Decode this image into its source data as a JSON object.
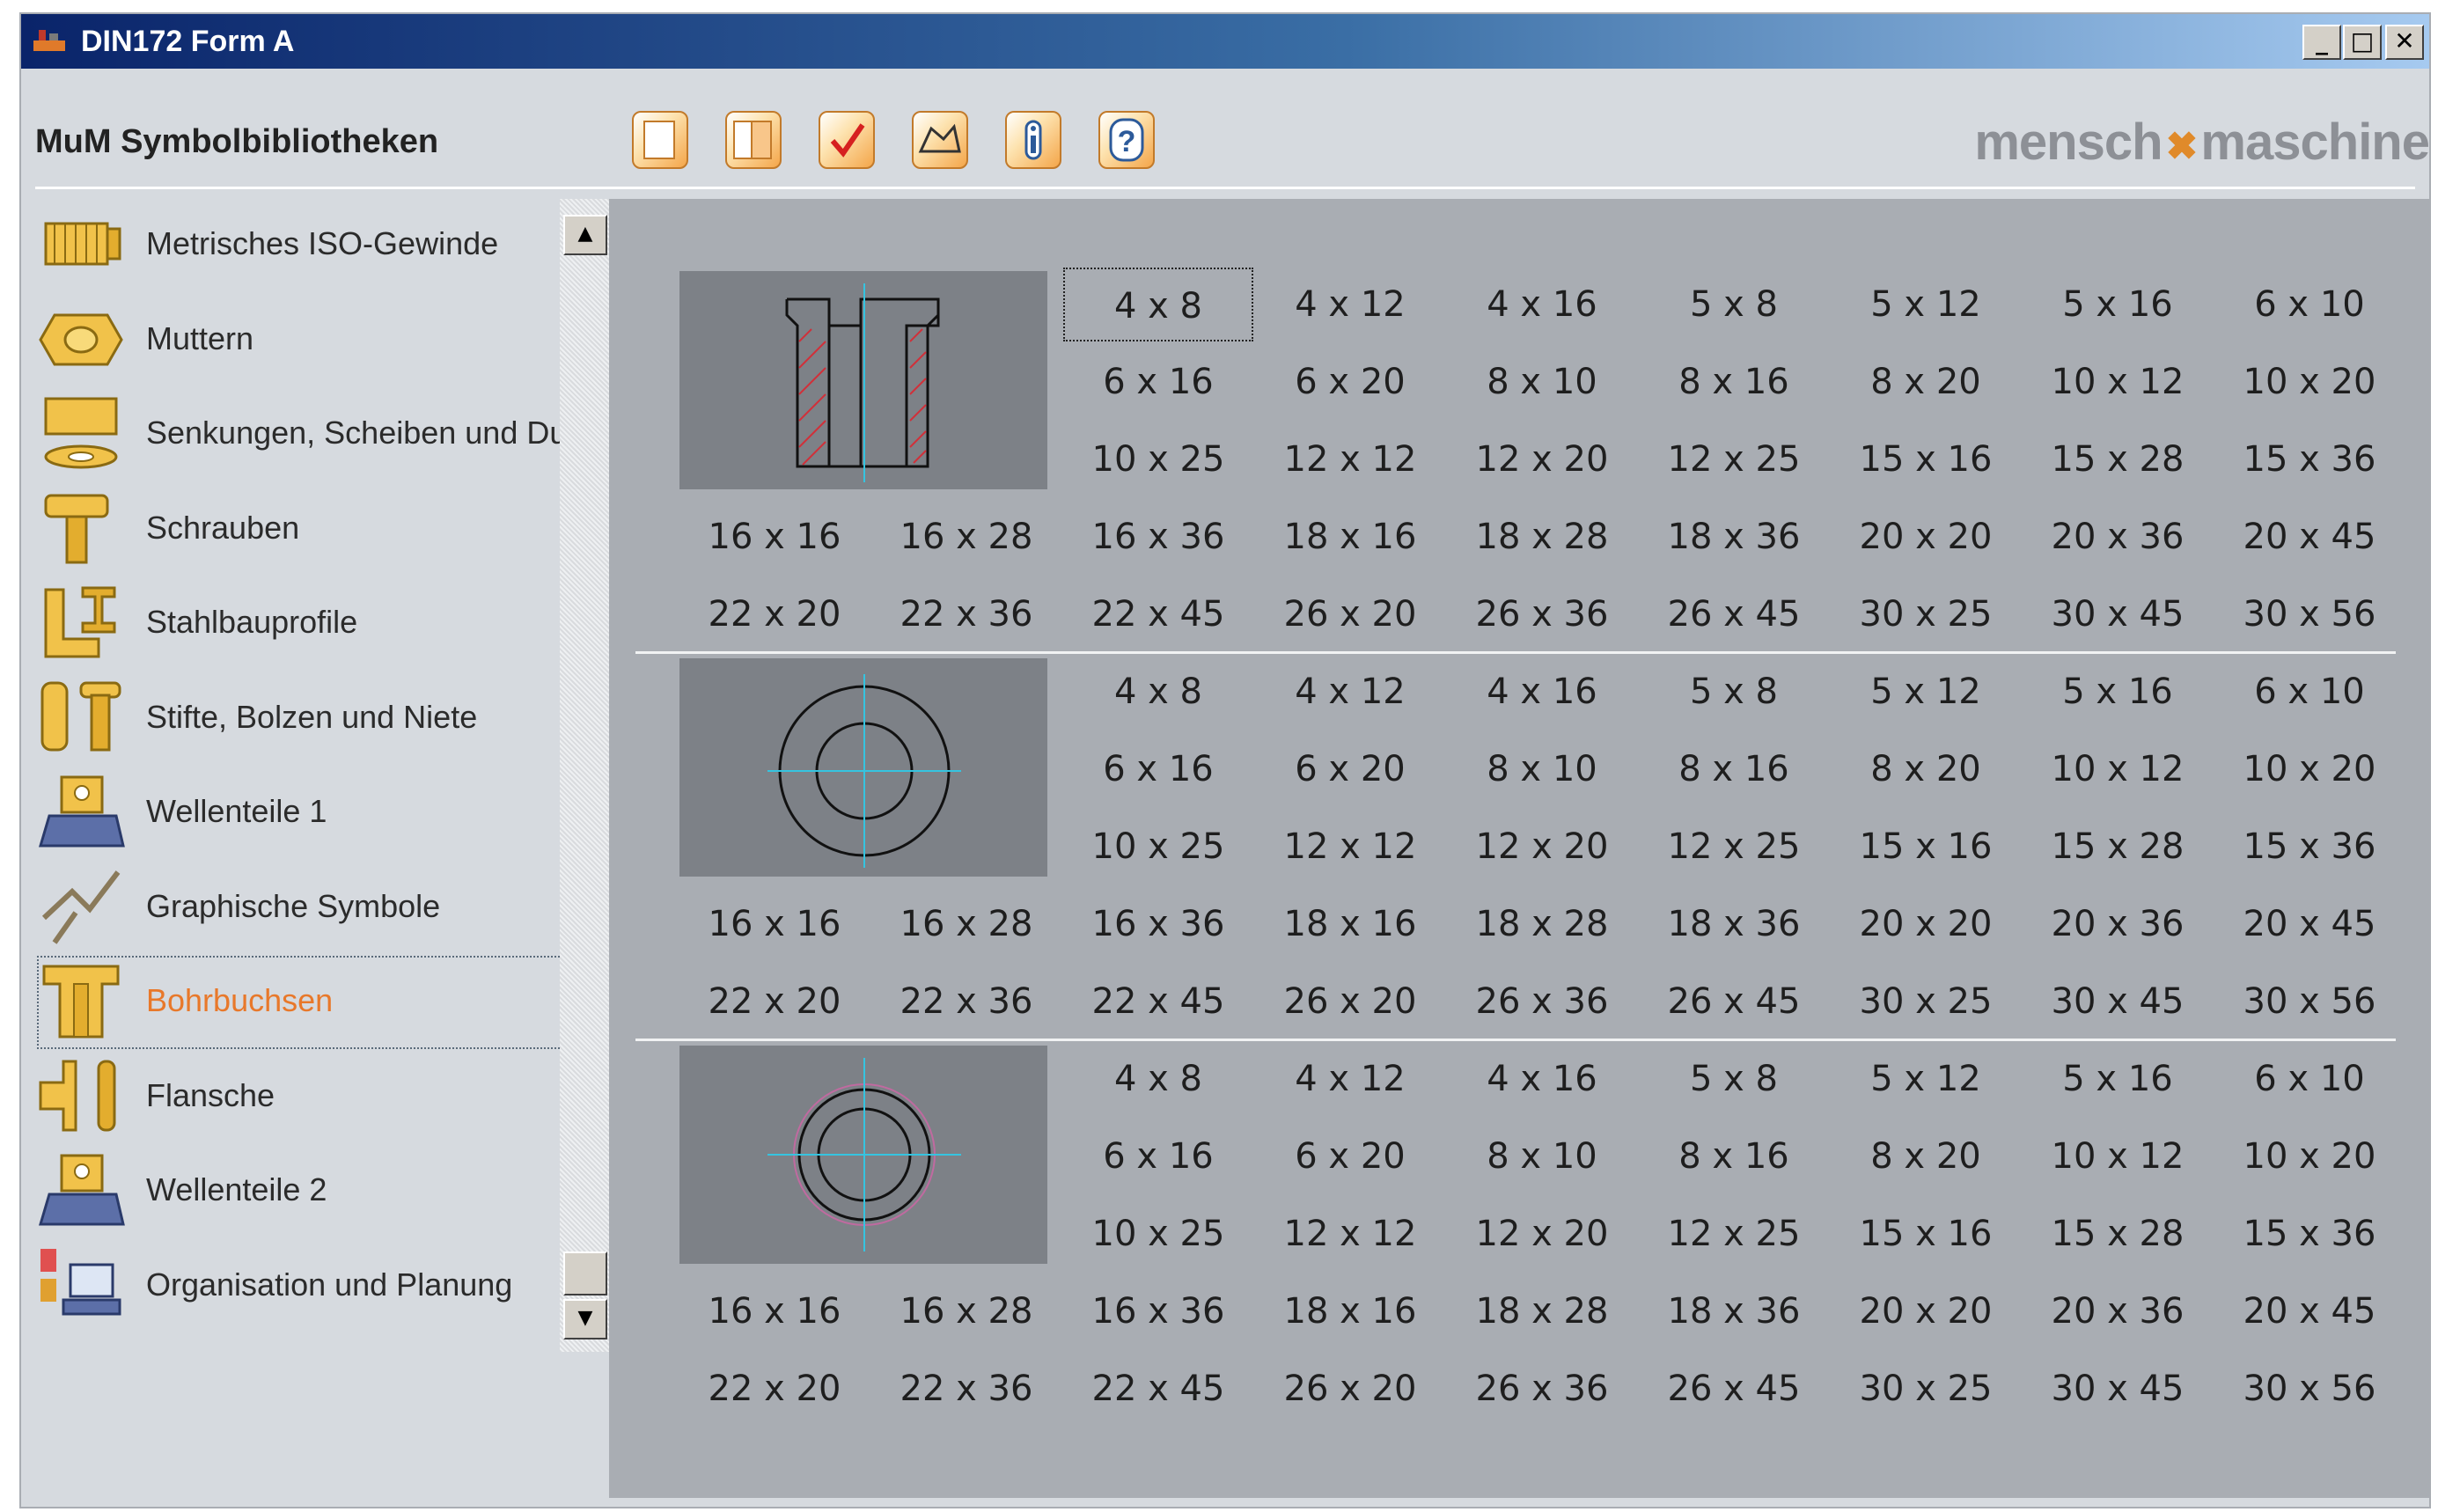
{
  "window": {
    "title": "DIN172 Form A",
    "minimize": "_",
    "maximize": "□",
    "close": "✕"
  },
  "header": {
    "brand_title": "MuM Symbolbibliotheken",
    "logo_left": "mensch",
    "logo_right": "maschine",
    "tools": [
      "new-icon",
      "page-icon",
      "check-icon",
      "folder-icon",
      "info-icon",
      "help-icon"
    ],
    "accent": "#f4a64a"
  },
  "sidebar": {
    "items": [
      {
        "label": "Metrisches ISO-Gewinde",
        "icon": "thread-icon"
      },
      {
        "label": "Muttern",
        "icon": "nut-icon"
      },
      {
        "label": "Senkungen, Scheiben und Du",
        "icon": "washer-icon"
      },
      {
        "label": "Schrauben",
        "icon": "screw-icon"
      },
      {
        "label": "Stahlbauprofile",
        "icon": "steel-profile-icon"
      },
      {
        "label": "Stifte, Bolzen und Niete",
        "icon": "pin-icon"
      },
      {
        "label": "Wellenteile 1",
        "icon": "shaft-icon"
      },
      {
        "label": "Graphische Symbole",
        "icon": "graphic-symbol-icon"
      },
      {
        "label": "Bohrbuchsen",
        "icon": "drill-bushing-icon",
        "active": true
      },
      {
        "label": "Flansche",
        "icon": "flange-icon"
      },
      {
        "label": "Wellenteile 2",
        "icon": "shaft-icon"
      },
      {
        "label": "Organisation und Planung",
        "icon": "organisation-icon"
      }
    ],
    "scroll_up": "▲",
    "scroll_down": "▼"
  },
  "main": {
    "sections": [
      {
        "preview": "bushing-section-view",
        "sizes": [
          "4 x 8",
          "4 x 12",
          "4 x 16",
          "5 x 8",
          "5 x 12",
          "5 x 16",
          "6 x 10",
          "6 x 16",
          "6 x 20",
          "8 x 10",
          "8 x 16",
          "8 x 20",
          "10 x 12",
          "10 x 20",
          "10 x 25",
          "12 x 12",
          "12 x 20",
          "12 x 25",
          "15 x 16",
          "15 x 28",
          "15 x 36",
          "16 x 16",
          "16 x 28",
          "16 x 36",
          "18 x 16",
          "18 x 28",
          "18 x 36",
          "20 x 20",
          "20 x 36",
          "20 x 45",
          "22 x 20",
          "22 x 36",
          "22 x 45",
          "26 x 20",
          "26 x 36",
          "26 x 45",
          "30 x 25",
          "30 x 45",
          "30 x 56"
        ]
      },
      {
        "preview": "bushing-top-view",
        "sizes": [
          "4 x 8",
          "4 x 12",
          "4 x 16",
          "5 x 8",
          "5 x 12",
          "5 x 16",
          "6 x 10",
          "6 x 16",
          "6 x 20",
          "8 x 10",
          "8 x 16",
          "8 x 20",
          "10 x 12",
          "10 x 20",
          "10 x 25",
          "12 x 12",
          "12 x 20",
          "12 x 25",
          "15 x 16",
          "15 x 28",
          "15 x 36",
          "16 x 16",
          "16 x 28",
          "16 x 36",
          "18 x 16",
          "18 x 28",
          "18 x 36",
          "20 x 20",
          "20 x 36",
          "20 x 45",
          "22 x 20",
          "22 x 36",
          "22 x 45",
          "26 x 20",
          "26 x 36",
          "26 x 45",
          "30 x 25",
          "30 x 45",
          "30 x 56"
        ]
      },
      {
        "preview": "bushing-bottom-view",
        "sizes": [
          "4 x 8",
          "4 x 12",
          "4 x 16",
          "5 x 8",
          "5 x 12",
          "5 x 16",
          "6 x 10",
          "6 x 16",
          "6 x 20",
          "8 x 10",
          "8 x 16",
          "8 x 20",
          "10 x 12",
          "10 x 20",
          "10 x 25",
          "12 x 12",
          "12 x 20",
          "12 x 25",
          "15 x 16",
          "15 x 28",
          "15 x 36",
          "16 x 16",
          "16 x 28",
          "16 x 36",
          "18 x 16",
          "18 x 28",
          "18 x 36",
          "20 x 20",
          "20 x 36",
          "20 x 45",
          "22 x 20",
          "22 x 36",
          "22 x 45",
          "26 x 20",
          "26 x 36",
          "26 x 45",
          "30 x 25",
          "30 x 45",
          "30 x 56"
        ]
      }
    ]
  }
}
